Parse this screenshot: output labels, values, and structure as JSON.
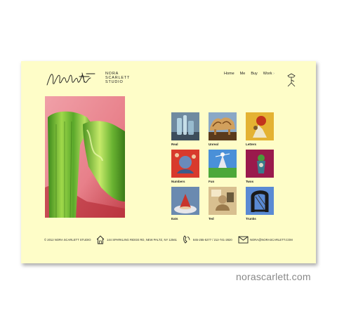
{
  "logo": {
    "signature": "Nora Scarlett",
    "line1": "NORA",
    "line2": "SCARLETT",
    "line3": "STUDIO"
  },
  "nav": {
    "items": [
      "Home",
      "Me",
      "Buy",
      "Work"
    ],
    "work_arrow": "›"
  },
  "gallery": {
    "items": [
      {
        "label": "Real"
      },
      {
        "label": "Unreal"
      },
      {
        "label": "Letters"
      },
      {
        "label": "Numbers"
      },
      {
        "label": "Fun"
      },
      {
        "label": "Twos"
      },
      {
        "label": "Eats"
      },
      {
        "label": "Ted"
      },
      {
        "label": "Trunks"
      }
    ]
  },
  "footer": {
    "copyright": "© 2012 NORA SCARLETT STUDIO",
    "address": "144 SPARKLING RIDGE RD, NEW PALTZ, NY 12561",
    "phone": "845-255-5277 / 212-741-2820",
    "email": "NORA@NORASCARLETT.COM"
  },
  "brand_caption": "norascarlett.com",
  "colors": {
    "page_bg": "#fefdc8",
    "outer_bg": "#ffffff",
    "caption": "#888888"
  },
  "icons": [
    "lamp-icon",
    "house-icon",
    "phone-icon",
    "envelope-icon"
  ]
}
